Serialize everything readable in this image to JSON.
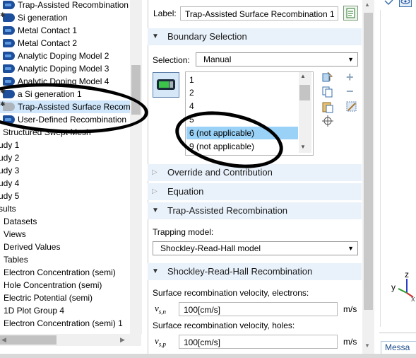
{
  "tree": {
    "items": [
      {
        "label": "Trap-Assisted Recombination",
        "icon": "recombination-feature-icon"
      },
      {
        "label": "Si generation",
        "icon": "generation-feature-icon"
      },
      {
        "label": "Metal Contact 1",
        "icon": "boundary-feature-icon"
      },
      {
        "label": "Metal Contact 2",
        "icon": "boundary-feature-icon"
      },
      {
        "label": "Analytic Doping Model 2",
        "icon": "doping-feature-icon"
      },
      {
        "label": "Analytic Doping Model 3",
        "icon": "doping-feature-icon"
      },
      {
        "label": "Analytic Doping Model 4",
        "icon": "doping-feature-icon"
      },
      {
        "label": "a Si generation 1",
        "icon": "generation-feature-icon"
      },
      {
        "label": "Trap-Assisted Surface Recomb",
        "icon": "surface-recombination-icon"
      },
      {
        "label": "User-Defined Recombination",
        "icon": "recombination-feature-icon"
      },
      {
        "label": "Structured Swept Mesh"
      },
      {
        "label": "udy 1"
      },
      {
        "label": "udy 2"
      },
      {
        "label": "udy 3"
      },
      {
        "label": "udy 4"
      },
      {
        "label": "udy 5"
      },
      {
        "label": "sults"
      },
      {
        "label": "Datasets"
      },
      {
        "label": "Views"
      },
      {
        "label": "Derived Values"
      },
      {
        "label": "Tables"
      },
      {
        "label": "Electron Concentration (semi)"
      },
      {
        "label": "Hole Concentration (semi)"
      },
      {
        "label": "Electric Potential (semi)"
      },
      {
        "label": "1D Plot Group 4"
      },
      {
        "label": "Electron Concentration (semi) 1"
      }
    ]
  },
  "settings": {
    "label_caption": "Label:",
    "label_value": "Trap-Assisted Surface Recombination 1",
    "boundary_selection": {
      "title": "Boundary Selection",
      "selection_caption": "Selection:",
      "selection_value": "Manual",
      "list": [
        "1",
        "2",
        "4",
        "5",
        "6 (not applicable)",
        "9 (not applicable)"
      ],
      "selected_index": 4
    },
    "override_title": "Override and Contribution",
    "equation_title": "Equation",
    "trap_section": {
      "title": "Trap-Assisted Recombination",
      "trapping_model_caption": "Trapping model:",
      "trapping_model_value": "Shockley-Read-Hall model"
    },
    "srh_section": {
      "title": "Shockley-Read-Hall Recombination",
      "electrons_caption": "Surface recombination velocity, electrons:",
      "vsn_symbol": "v",
      "vsn_sub": "s,n",
      "vsn_value": "100[cm/s]",
      "vsn_unit": "m/s",
      "holes_caption": "Surface recombination velocity, holes:",
      "vsp_symbol": "v",
      "vsp_sub": "s,p",
      "vsp_value": "100[cm/s]",
      "vsp_unit": "m/s"
    }
  },
  "graphics": {
    "axes": {
      "x": "x",
      "y": "y",
      "z": "z"
    },
    "messages_tab": "Messa"
  },
  "colors": {
    "section_bg": "#e9f1fa",
    "tree_selected": "#cfe6fb",
    "list_selected": "#99d1f7",
    "annotation": "#000000"
  }
}
